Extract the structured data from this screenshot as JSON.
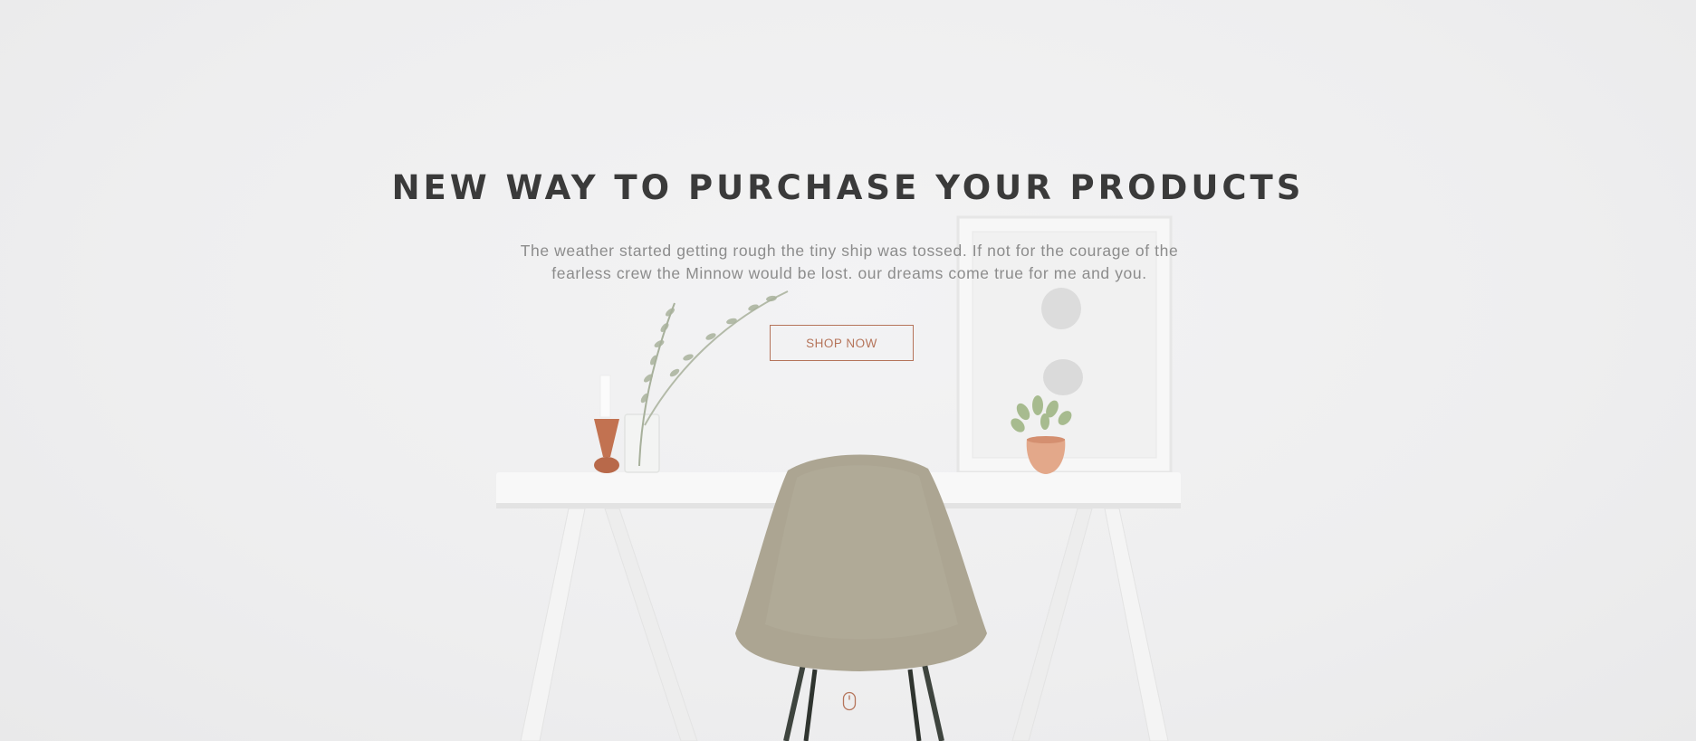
{
  "hero": {
    "headline": "NEW WAY TO PURCHASE YOUR PRODUCTS",
    "subtext": "The weather started getting rough the tiny ship was tossed. If not for the courage of the fearless crew the Minnow would be lost. our dreams come true for me and you.",
    "cta_label": "SHOP NOW"
  },
  "icons": {
    "scroll": "mouse-scroll-icon"
  },
  "colors": {
    "accent": "#b5745a",
    "headline": "#3a3a3a",
    "body_text": "#8c8c8c",
    "background": "#efeff0"
  }
}
